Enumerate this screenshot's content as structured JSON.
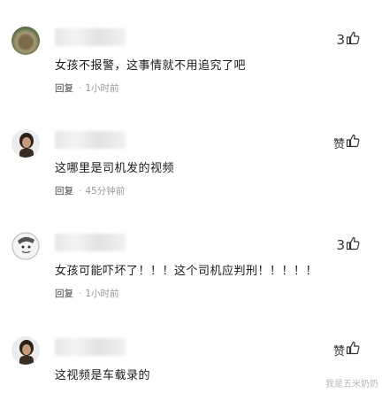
{
  "comments": [
    {
      "text": "女孩不报警，这事情就不用追究了吧",
      "likes": "3",
      "reply_label": "回复",
      "time": "1小时前"
    },
    {
      "text": "这哪里是司机发的视频",
      "likes": "赞",
      "reply_label": "回复",
      "time": "45分钟前"
    },
    {
      "text": "女孩可能吓坏了！！！这个司机应判刑！！！！！",
      "likes": "3",
      "reply_label": "回复",
      "time": "1小时前"
    },
    {
      "text": "这视频是车载录的",
      "likes": "赞"
    }
  ],
  "watermark": "我是五米奶奶",
  "icons": {
    "like": "thumbs-up-icon"
  }
}
